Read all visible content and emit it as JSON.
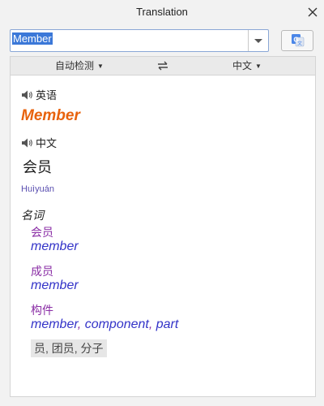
{
  "window": {
    "title": "Translation"
  },
  "search": {
    "value": "Member"
  },
  "lang_bar": {
    "source": "自动检测",
    "target": "中文"
  },
  "result": {
    "source_lang": "英语",
    "source_word": "Member",
    "target_lang": "中文",
    "target_word": "会员",
    "pinyin": "Huìyuán",
    "part_of_speech": "名词",
    "senses": [
      {
        "zh": "会员",
        "en": [
          "member"
        ]
      },
      {
        "zh": "成员",
        "en": [
          "member"
        ]
      },
      {
        "zh": "构件",
        "en": [
          "member",
          "component",
          "part"
        ]
      }
    ],
    "synonyms": "员, 团员, 分子"
  },
  "colors": {
    "accent": "#3b78d8",
    "source_word": "#e8620c",
    "sense_zh": "#8a2da5",
    "sense_en": "#3333c8"
  },
  "icons": {
    "close": "close-icon",
    "dropdown": "chevron-down-icon",
    "translate": "google-translate-icon",
    "swap": "swap-icon",
    "speaker": "speaker-icon"
  }
}
